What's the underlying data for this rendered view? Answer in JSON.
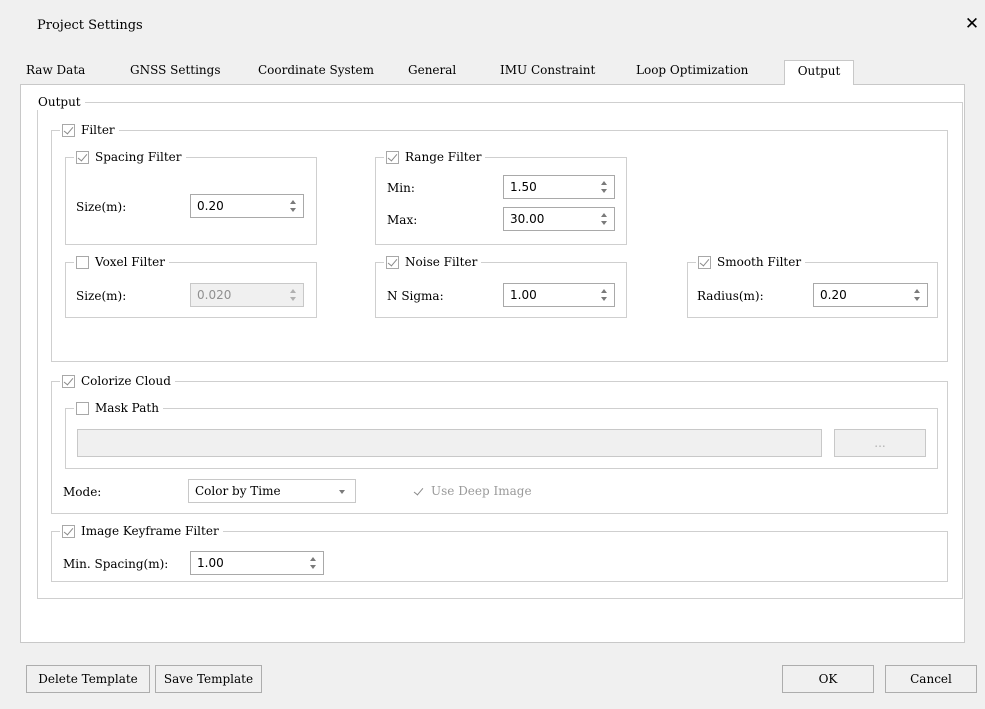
{
  "window": {
    "title": "Project Settings",
    "close_glyph": "✕"
  },
  "tabs": [
    "Raw Data",
    "GNSS Settings",
    "Coordinate System",
    "General",
    "IMU Constraint",
    "Loop Optimization",
    "Output"
  ],
  "output": {
    "group_label": "Output",
    "filter": {
      "label": "Filter",
      "checked": true,
      "spacing": {
        "label": "Spacing Filter",
        "checked": true,
        "size_label": "Size(m):",
        "size_value": "0.20"
      },
      "range": {
        "label": "Range Filter",
        "checked": true,
        "min_label": "Min:",
        "min_value": "1.50",
        "max_label": "Max:",
        "max_value": "30.00"
      },
      "voxel": {
        "label": "Voxel Filter",
        "checked": false,
        "size_label": "Size(m):",
        "size_value": "0.020"
      },
      "noise": {
        "label": "Noise Filter",
        "checked": true,
        "nsigma_label": "N Sigma:",
        "nsigma_value": "1.00"
      },
      "smooth": {
        "label": "Smooth Filter",
        "checked": true,
        "radius_label": "Radius(m):",
        "radius_value": "0.20"
      }
    },
    "colorize": {
      "label": "Colorize Cloud",
      "checked": true,
      "mask": {
        "label": "Mask Path",
        "checked": false,
        "path_value": "",
        "browse_label": "..."
      },
      "mode_label": "Mode:",
      "mode_value": "Color by Time",
      "deep_image_label": "Use Deep Image",
      "deep_image_checked": true
    },
    "keyframe": {
      "label": "Image Keyframe Filter",
      "checked": true,
      "spacing_label": "Min. Spacing(m):",
      "spacing_value": "1.00"
    }
  },
  "footer": {
    "delete_template": "Delete Template",
    "save_template": "Save Template",
    "ok": "OK",
    "cancel": "Cancel"
  }
}
